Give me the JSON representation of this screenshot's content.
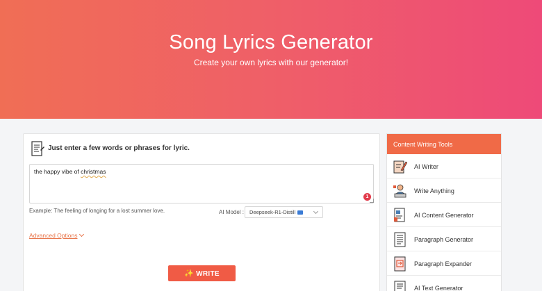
{
  "hero": {
    "title": "Song Lyrics Generator",
    "subtitle": "Create your own lyrics with our generator!"
  },
  "form": {
    "instruction": "Just enter a few words or phrases for lyric.",
    "input_value_prefix": "the happy vibe of ",
    "input_value_word": "christmas",
    "char_badge": "1",
    "example": "Example: The feeling of longing for a lost summer love.",
    "model_label": "AI Model :",
    "model_value": "Deepseek-R1-Distill",
    "advanced_options": "Advanced Options",
    "write_label": "WRITE"
  },
  "sidebar": {
    "header": "Content Writing Tools",
    "items": [
      {
        "label": "AI Writer",
        "icon": "writer-icon"
      },
      {
        "label": "Write Anything",
        "icon": "person-laptop-icon"
      },
      {
        "label": "AI Content Generator",
        "icon": "content-doc-icon"
      },
      {
        "label": "Paragraph Generator",
        "icon": "paragraph-doc-icon"
      },
      {
        "label": "Paragraph Expander",
        "icon": "expander-doc-icon"
      },
      {
        "label": "AI Text Generator",
        "icon": "text-doc-icon"
      }
    ]
  },
  "colors": {
    "hero_start": "#f06e55",
    "hero_end": "#ee4a78",
    "accent": "#f05b45",
    "sidebar_header": "#f06a47",
    "link": "#e8754a"
  }
}
